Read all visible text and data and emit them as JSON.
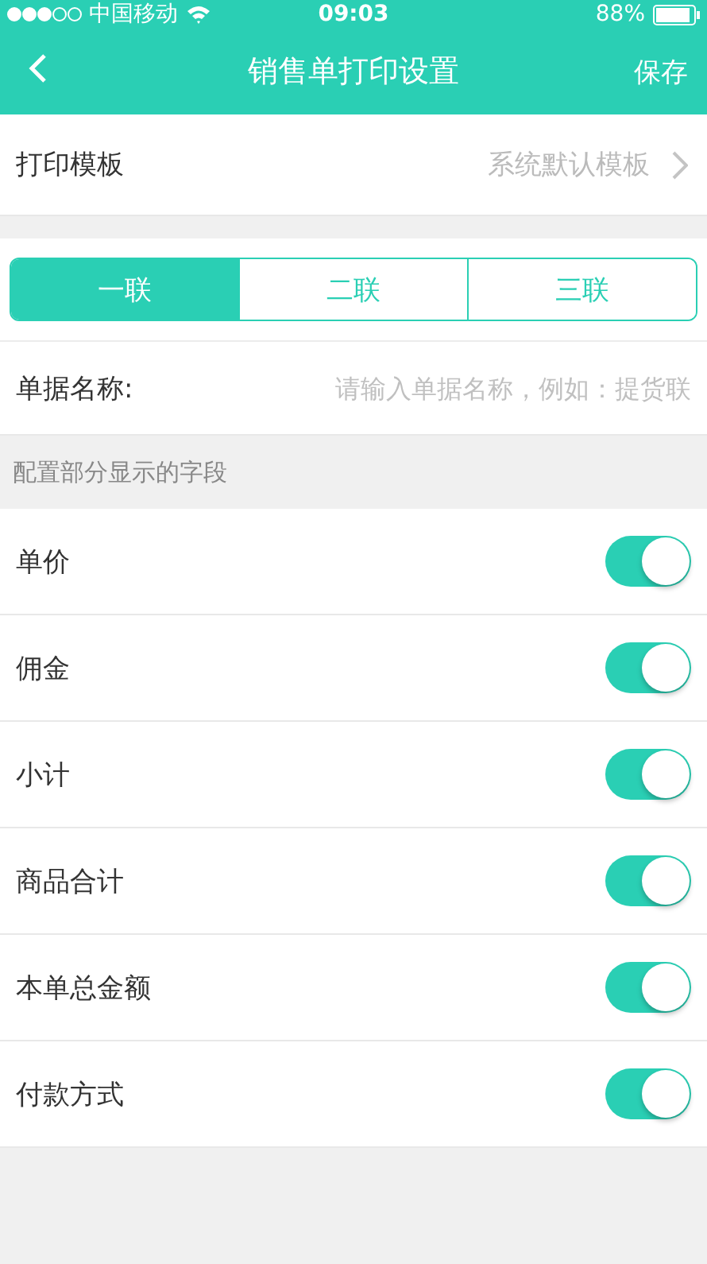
{
  "status_bar": {
    "carrier": "中国移动",
    "time": "09:03",
    "battery": "88%"
  },
  "nav": {
    "title": "销售单打印设置",
    "action": "保存"
  },
  "template_row": {
    "label": "打印模板",
    "value": "系统默认模板"
  },
  "tabs": [
    {
      "label": "一联",
      "selected": true
    },
    {
      "label": "二联",
      "selected": false
    },
    {
      "label": "三联",
      "selected": false
    }
  ],
  "name_field": {
    "label": "单据名称:",
    "placeholder": "请输入单据名称，例如：提货联"
  },
  "section_header": "配置部分显示的字段",
  "fields": [
    {
      "label": "单价",
      "on": true
    },
    {
      "label": "佣金",
      "on": true
    },
    {
      "label": "小计",
      "on": true
    },
    {
      "label": "商品合计",
      "on": true
    },
    {
      "label": "本单总金额",
      "on": true
    },
    {
      "label": "付款方式",
      "on": true
    }
  ]
}
